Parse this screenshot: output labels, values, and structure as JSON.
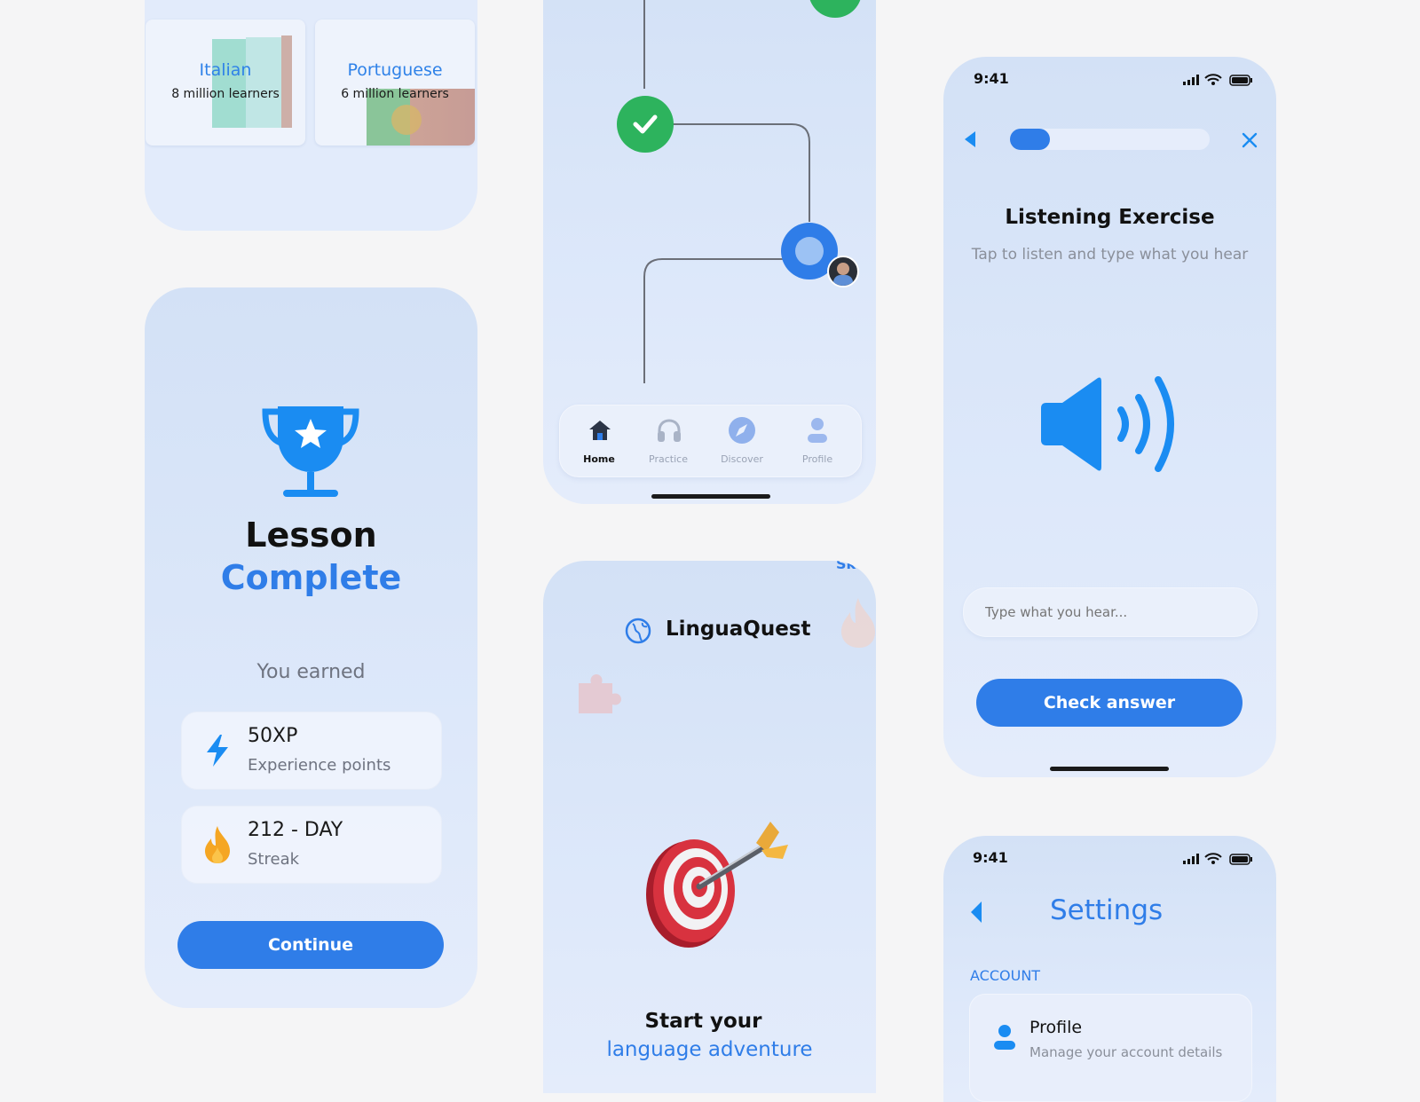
{
  "languages": {
    "items": [
      {
        "name": "Italian",
        "learners": "8 million learners"
      },
      {
        "name": "Portuguese",
        "learners": "6 million learners"
      }
    ]
  },
  "lesson_complete": {
    "title_line1": "Lesson",
    "title_line2": "Complete",
    "earned_label": "You earned",
    "stats": [
      {
        "value": "50XP",
        "label": "Experience points",
        "icon": "lightning-icon"
      },
      {
        "value": "212 - DAY",
        "label": "Streak",
        "icon": "flame-icon"
      }
    ],
    "continue_label": "Continue",
    "accent_color": "#2f7de8"
  },
  "path_map": {
    "tabs": [
      {
        "label": "Home",
        "icon": "home-icon",
        "active": true
      },
      {
        "label": "Practice",
        "icon": "headphones-icon",
        "active": false
      },
      {
        "label": "Discover",
        "icon": "compass-icon",
        "active": false
      },
      {
        "label": "Profile",
        "icon": "person-icon",
        "active": false
      }
    ]
  },
  "onboarding": {
    "app_name": "LinguaQuest",
    "skip_label": "Sk",
    "headline_line1": "Start your",
    "headline_line2": "language adventure"
  },
  "listening": {
    "status_time": "9:41",
    "progress": 0.2,
    "title": "Listening Exercise",
    "subtitle": "Tap to listen and type what you hear",
    "input_placeholder": "Type what you hear...",
    "check_label": "Check answer"
  },
  "settings": {
    "status_time": "9:41",
    "title": "Settings",
    "section_label": "ACCOUNT",
    "items": [
      {
        "title": "Profile",
        "subtitle": "Manage your account details"
      }
    ]
  }
}
